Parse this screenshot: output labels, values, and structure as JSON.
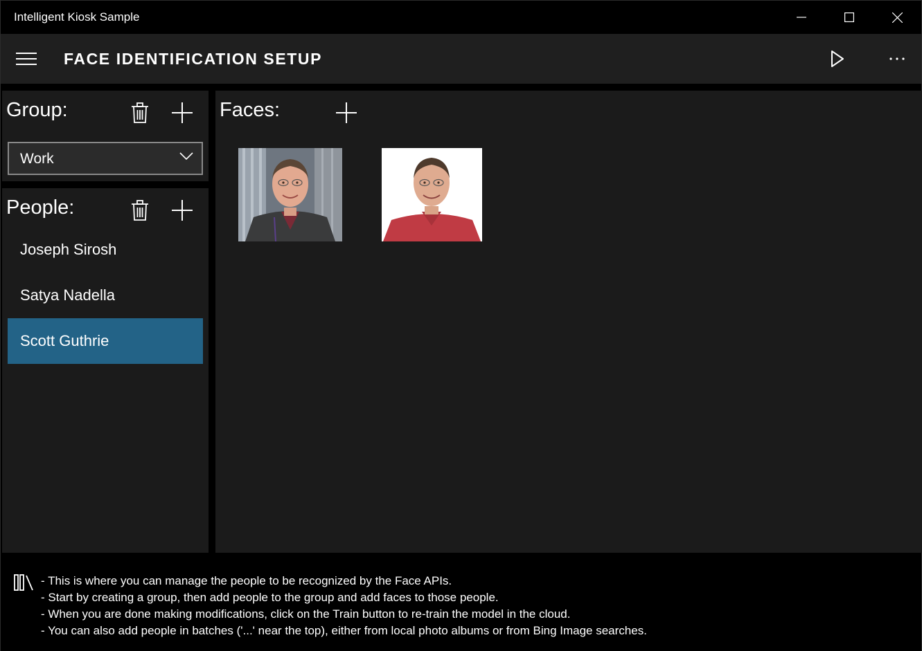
{
  "window": {
    "title": "Intelligent Kiosk Sample"
  },
  "appbar": {
    "page_title": "FACE IDENTIFICATION SETUP"
  },
  "group": {
    "label": "Group:",
    "selected": "Work"
  },
  "people": {
    "label": "People:",
    "items": [
      {
        "name": "Joseph Sirosh",
        "selected": false
      },
      {
        "name": "Satya Nadella",
        "selected": false
      },
      {
        "name": "Scott Guthrie",
        "selected": true
      }
    ]
  },
  "faces": {
    "label": "Faces:",
    "count": 2
  },
  "info": {
    "lines": [
      "- This is where you can manage the people to be recognized by the Face APIs.",
      "- Start by creating a group, then add people to the group and add faces to those people.",
      "- When you are done making modifications, click on the Train button to re-train the model in the cloud.",
      "- You can also add people in batches ('...' near the top), either from local photo albums or from Bing Image searches."
    ]
  },
  "colors": {
    "selected_item": "#236387",
    "panel_bg": "#1b1b1b",
    "appbar_bg": "#1f1f1f"
  }
}
